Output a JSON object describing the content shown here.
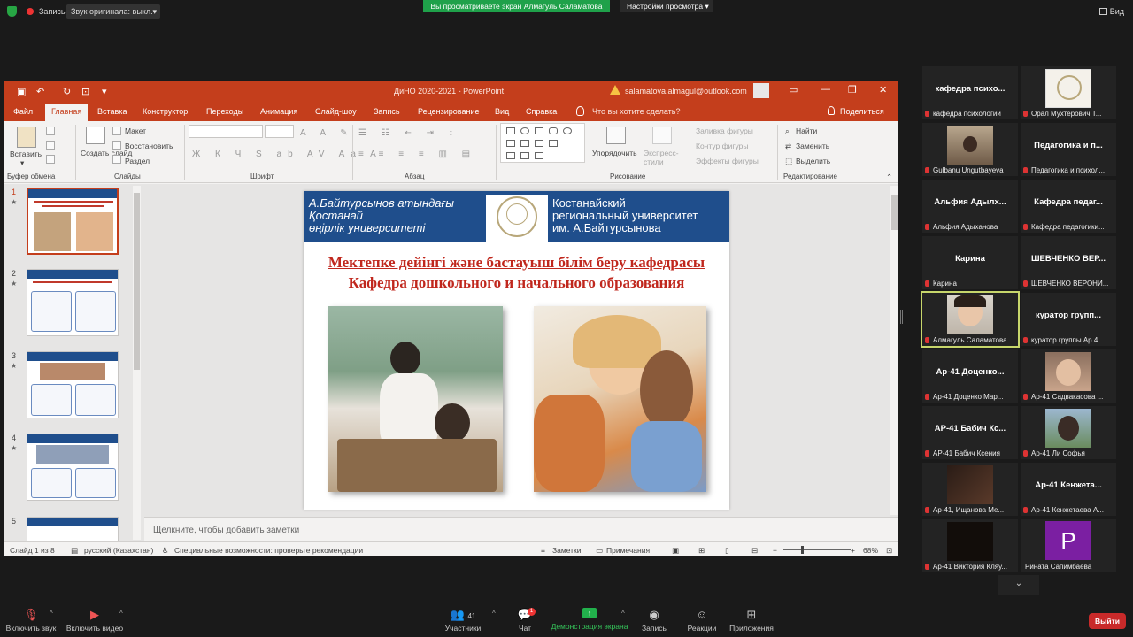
{
  "topbar": {
    "record_label": "Запись",
    "audio_select": "Звук оригинала: выкл.",
    "share_banner": "Вы просматриваете экран Алмагуль Саламатова",
    "view_options": "Настройки просмотра",
    "view_button": "Вид"
  },
  "ppt": {
    "doc_title": "ДиНО 2020-2021  -  PowerPoint",
    "account_email": "salamatova.almagul@outlook.com",
    "tabs": [
      "Файл",
      "Главная",
      "Вставка",
      "Конструктор",
      "Переходы",
      "Анимация",
      "Слайд-шоу",
      "Запись",
      "Рецензирование",
      "Вид",
      "Справка"
    ],
    "tell_me": "Что вы хотите сделать?",
    "share": "Поделиться",
    "ribbon": {
      "paste": "Вставить",
      "clipboard": "Буфер обмена",
      "new_slide": "Создать слайд",
      "layout": "Макет",
      "reset": "Восстановить",
      "section": "Раздел",
      "slides": "Слайды",
      "font": "Шрифт",
      "paragraph": "Абзац",
      "arrange": "Упорядочить",
      "quick_styles": "Экспресс-стили",
      "shape_fill": "Заливка фигуры",
      "shape_outline": "Контур фигуры",
      "shape_effects": "Эффекты фигуры",
      "drawing": "Рисование",
      "find": "Найти",
      "replace": "Заменить",
      "select": "Выделить",
      "editing": "Редактирование"
    },
    "slide": {
      "banner_left_1": "А.Байтурсынов атындағы",
      "banner_left_2": "Қостанай",
      "banner_left_3": "өңірлік университеті",
      "banner_right_1": "Костанайский",
      "banner_right_2": "региональный университет",
      "banner_right_3": "им. А.Байтурсынова",
      "title_kz": "Мектепке дейінгі және бастауыш білім беру кафедрасы",
      "title_ru": "Кафедра дошкольного и начального образования"
    },
    "thumb_numbers": [
      "1",
      "2",
      "3",
      "4",
      "5"
    ],
    "notes_placeholder": "Щелкните, чтобы добавить заметки",
    "status": {
      "slide_of": "Слайд 1 из 8",
      "language": "русский (Казахстан)",
      "accessibility": "Специальные возможности: проверьте рекомендации",
      "notes": "Заметки",
      "comments": "Примечания",
      "zoom": "68%"
    }
  },
  "participants": [
    {
      "display": "кафедра  психо...",
      "caption": "кафедра психологии"
    },
    {
      "display": "",
      "caption": "Орал Мухтерович Т..."
    },
    {
      "display": "",
      "caption": "Gulbanu Ungutbayeva"
    },
    {
      "display": "Педагогика  и  п...",
      "caption": "Педагогика и психол..."
    },
    {
      "display": "Альфия  Адылх...",
      "caption": "Альфия Адыханова"
    },
    {
      "display": "Кафедра  педаг...",
      "caption": "Кафедра педагогики..."
    },
    {
      "display": "Карина",
      "caption": "Карина"
    },
    {
      "display": "ШЕВЧЕНКО  ВЕР...",
      "caption": "ШЕВЧЕНКО ВЕРОНИ..."
    },
    {
      "display": "",
      "caption": "Алмагуль Саламатова"
    },
    {
      "display": "куратор  групп...",
      "caption": "куратор группы Ар 4..."
    },
    {
      "display": "Ар-41  Доценко...",
      "caption": "Ар-41 Доценко Мар..."
    },
    {
      "display": "",
      "caption": "Ар-41 Садвакасова ..."
    },
    {
      "display": "АР-41  Бабич  Кс...",
      "caption": "АР-41 Бабич Ксения"
    },
    {
      "display": "",
      "caption": "Ар-41 Ли Софья"
    },
    {
      "display": "",
      "caption": "Ар-41, Ищанова Ме..."
    },
    {
      "display": "Ар-41  Кенжета...",
      "caption": "Ар-41 Кенжетаева А..."
    },
    {
      "display": "",
      "caption": "Ар-41 Виктория Кляу..."
    },
    {
      "display": "",
      "caption": "Рината Сапимбаева"
    }
  ],
  "purple_letter": "P",
  "controls": {
    "mute": "Включить звук",
    "video": "Включить видео",
    "participants": "Участники",
    "participants_count": "41",
    "chat": "Чат",
    "chat_badge": "1",
    "share": "Демонстрация экрана",
    "record": "Запись",
    "reactions": "Реакции",
    "apps": "Приложения",
    "end": "Выйти"
  },
  "colors": {
    "ppt_accent": "#c43e1c",
    "slide_banner": "#1f4e8c",
    "title_red": "#c0271d",
    "share_green": "#1fa14a"
  }
}
